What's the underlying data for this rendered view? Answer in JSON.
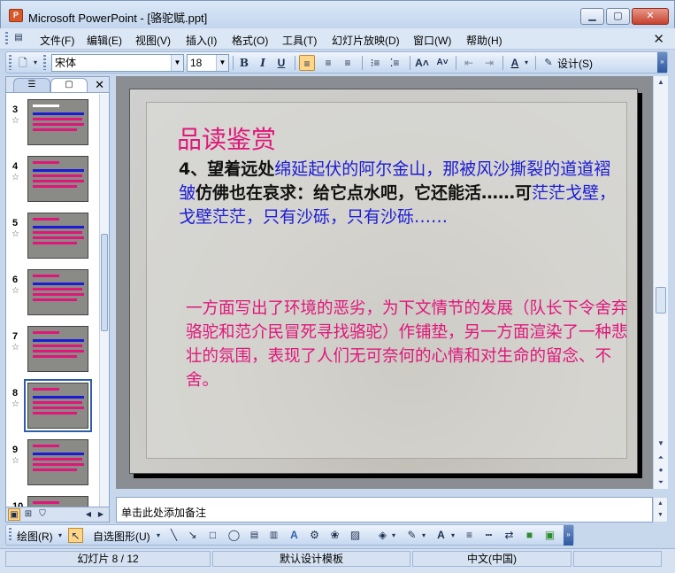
{
  "window": {
    "title": "Microsoft PowerPoint - [骆驼赋.ppt]",
    "app_icon_text": "P"
  },
  "menu": {
    "items": [
      "文件(F)",
      "编辑(E)",
      "视图(V)",
      "插入(I)",
      "格式(O)",
      "工具(T)",
      "幻灯片放映(D)",
      "窗口(W)",
      "帮助(H)"
    ]
  },
  "toolbar": {
    "font_name": "宋体",
    "font_size": "18",
    "bold": "B",
    "italic": "I",
    "underline": "U",
    "design_label": "设计(S)"
  },
  "thumbnails": [
    {
      "number": "3",
      "title_color": "#ffffff",
      "selected": false
    },
    {
      "number": "4",
      "title_color": "#e0167a",
      "selected": false
    },
    {
      "number": "5",
      "title_color": "#e0167a",
      "selected": false
    },
    {
      "number": "6",
      "title_color": "#e0167a",
      "selected": false
    },
    {
      "number": "7",
      "title_color": "#e0167a",
      "selected": false
    },
    {
      "number": "8",
      "title_color": "#e0167a",
      "selected": true
    },
    {
      "number": "9",
      "title_color": "#e0167a",
      "selected": false
    },
    {
      "number": "10",
      "title_color": "#e0167a",
      "selected": false
    }
  ],
  "slide": {
    "heading": "品读鉴赏",
    "body_number": "4、",
    "body_segments": [
      {
        "text": "望着远处",
        "color": "black"
      },
      {
        "text": "绵延起伏的阿尔金山，那被风沙撕裂的道道褶皱",
        "color": "blue"
      },
      {
        "text": "仿佛也在哀求：给它点水吧，它还能活……可",
        "color": "black"
      },
      {
        "text": "茫茫戈壁，戈壁茫茫，只有沙砾，只有沙砾……",
        "color": "blue"
      }
    ],
    "note": "一方面写出了环境的恶劣，为下文情节的发展（队长下令舍弃骆驼和范介民冒死寻找骆驼）作铺垫，另一方面渲染了一种悲壮的氛围，表现了人们无可奈何的心情和对生命的留念、不舍。",
    "colors": {
      "heading": "#e0167a",
      "blue": "#1c1cd6",
      "note": "#e0167a"
    }
  },
  "notes_pane": {
    "placeholder": "单击此处添加备注"
  },
  "drawing_toolbar": {
    "draw_label": "绘图(R)",
    "autoshape_label": "自选图形(U)"
  },
  "status": {
    "slide_info": "幻灯片 8 / 12",
    "template": "默认设计模板",
    "language": "中文(中国)"
  }
}
